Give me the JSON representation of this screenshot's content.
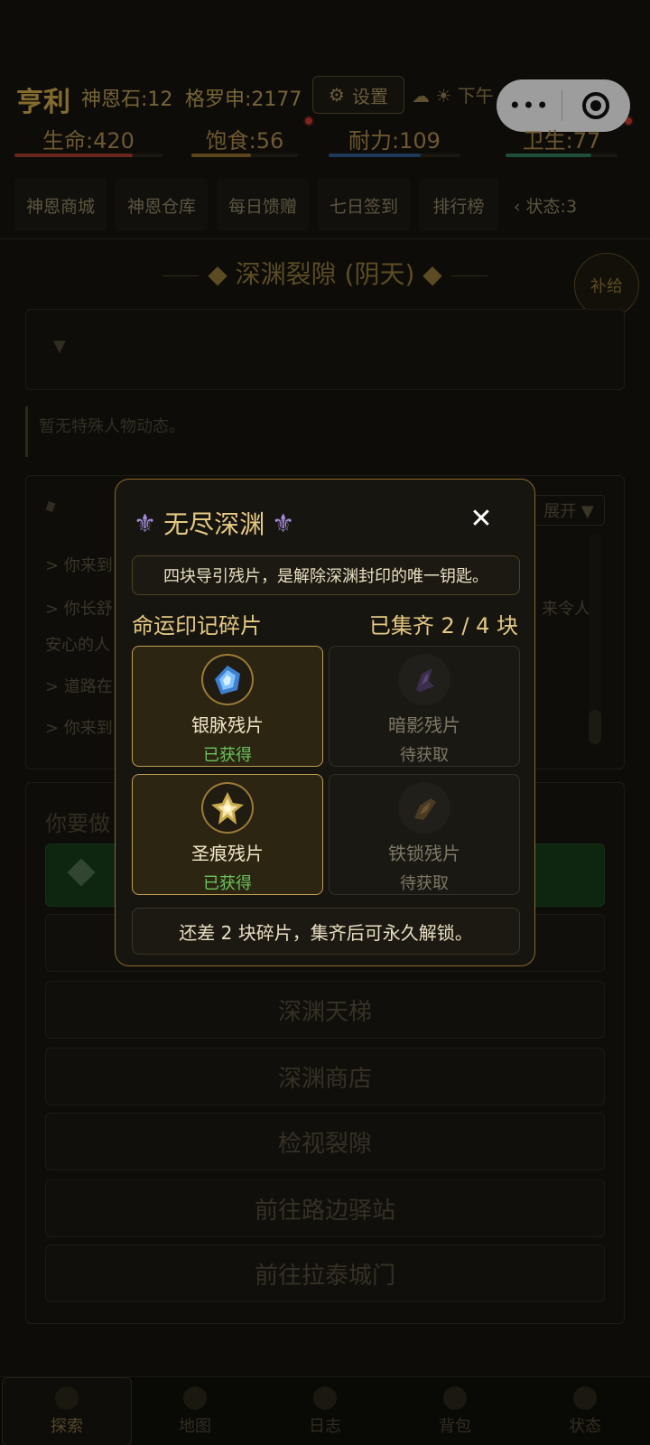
{
  "header": {
    "name": "亨利",
    "shen_en_stone": "神恩石:12",
    "groschen": "格罗申:2177",
    "settings_label": "设置",
    "weather": "☁ ☀ 下午 · 第13天"
  },
  "gauges": [
    {
      "label": "生命:420",
      "color": "#a23a2e",
      "fill": 0.8
    },
    {
      "label": "饱食:56",
      "color": "#8a6a2c",
      "fill": 0.56
    },
    {
      "label": "耐力:109",
      "color": "#2e5a8a",
      "fill": 0.7
    },
    {
      "label": "卫生:77",
      "color": "#2e7a5a",
      "fill": 0.77
    }
  ],
  "tabs": [
    "神恩商城",
    "神恩仓库",
    "每日馈赠",
    "七日签到",
    "排行榜",
    "‹ 状态:3"
  ],
  "location_title": "◆ 深渊裂隙 (阴天) ◆",
  "supply_label": "补给",
  "notice": "暂无特殊人物动态。",
  "log": {
    "expand_label": "展开 ▼",
    "lines": [
      "> 你来到",
      "> 你长舒",
      "安心的人",
      "> 道路在",
      "> 你来到"
    ],
    "trail": "来令人"
  },
  "choices": {
    "prompt": "你要做",
    "buttons": [
      "深渊天梯",
      "深渊商店",
      "检视裂隙",
      "前往路边驿站",
      "前往拉泰城门"
    ]
  },
  "modal": {
    "title": "无尽深渊",
    "description": "四块导引残片，是解除深渊封印的唯一钥匙。",
    "fragments_title": "命运印记碎片",
    "progress": "已集齐 2 / 4 块",
    "fragments": [
      {
        "name": "银脉残片",
        "status": "已获得"
      },
      {
        "name": "暗影残片",
        "status": "待获取"
      },
      {
        "name": "圣痕残片",
        "status": "已获得"
      },
      {
        "name": "铁锁残片",
        "status": "待获取"
      }
    ],
    "footer": "还差 2 块碎片，集齐后可永久解锁。"
  },
  "nav": [
    "探索",
    "地图",
    "日志",
    "背包",
    "状态"
  ]
}
